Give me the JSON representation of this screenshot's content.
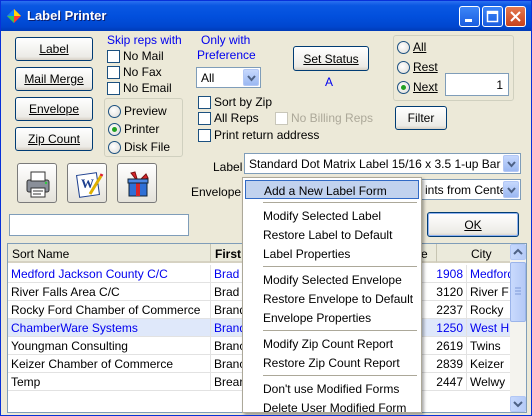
{
  "window": {
    "title": "Label Printer"
  },
  "left_buttons": [
    {
      "label": "Label"
    },
    {
      "label": "Mail Merge"
    },
    {
      "label": "Envelope"
    },
    {
      "label": "Zip Count"
    }
  ],
  "skip_reps": {
    "heading": "Skip reps with",
    "options": [
      {
        "label": "No Mail",
        "checked": false
      },
      {
        "label": "No Fax",
        "checked": false
      },
      {
        "label": "No Email",
        "checked": false
      }
    ]
  },
  "output": {
    "options": [
      {
        "label": "Preview",
        "selected": false
      },
      {
        "label": "Printer",
        "selected": true
      },
      {
        "label": "Disk File",
        "selected": false
      }
    ]
  },
  "preference": {
    "heading_line1": "Only with",
    "heading_line2": "Preference",
    "selected": "All"
  },
  "set_status": {
    "label": "Set Status",
    "status_value": "A"
  },
  "options_checks": [
    {
      "label": "Sort by Zip",
      "checked": false,
      "disabled": false
    },
    {
      "label": "All Reps",
      "checked": false,
      "disabled": false
    },
    {
      "label": "No Billing Reps",
      "checked": false,
      "disabled": true
    },
    {
      "label": "Print return address",
      "checked": false,
      "disabled": false
    }
  ],
  "range": {
    "options": [
      {
        "label": "All",
        "selected": false
      },
      {
        "label": "Rest",
        "selected": false
      },
      {
        "label": "Next",
        "selected": true
      }
    ],
    "next_count": "1"
  },
  "filter_button": {
    "label": "Filter"
  },
  "ok_button": {
    "label": "OK"
  },
  "label_select": {
    "caption": "Label",
    "value": "Standard Dot Matrix Label 15/16 x 3.5 1-up Bar"
  },
  "envelope_select": {
    "caption": "Envelope",
    "value": "ints from Cente"
  },
  "search": {
    "value": ""
  },
  "table": {
    "columns": [
      "Sort Name",
      "First",
      "e",
      "City"
    ],
    "rows": [
      {
        "sort_name": "Medford Jackson County C/C",
        "first": "Brad",
        "zip": "1908",
        "city": "Medford",
        "link": true,
        "selected": false
      },
      {
        "sort_name": "River Falls Area C/C",
        "first": "Brad",
        "zip": "3120",
        "city": "River F",
        "link": false,
        "selected": false
      },
      {
        "sort_name": "Rocky Ford Chamber of Commerce",
        "first": "Brand",
        "zip": "2237",
        "city": "Rocky",
        "link": false,
        "selected": false
      },
      {
        "sort_name": "ChamberWare Systems",
        "first": "Brand",
        "zip": "1250",
        "city": "West H",
        "link": true,
        "selected": true
      },
      {
        "sort_name": "Youngman Consulting",
        "first": "Branc",
        "zip": "2619",
        "city": "Twins",
        "link": false,
        "selected": false
      },
      {
        "sort_name": "Keizer Chamber of Commerce",
        "first": "Branc",
        "zip": "2839",
        "city": "Keizer",
        "link": false,
        "selected": false
      },
      {
        "sort_name": "Temp",
        "first": "Brear",
        "zip": "2447",
        "city": "Welwy",
        "link": false,
        "selected": false
      }
    ]
  },
  "context_menu": {
    "groups": [
      [
        "Add a New Label Form"
      ],
      [
        "Modify Selected Label",
        "Restore Label to Default",
        "Label Properties"
      ],
      [
        "Modify Selected Envelope",
        "Restore Envelope to Default",
        "Envelope Properties"
      ],
      [
        "Modify Zip Count Report",
        "Restore Zip Count Report"
      ],
      [
        "Don't use Modified Forms",
        "Delete User Modified Form"
      ]
    ],
    "highlighted": "Add a New Label Form"
  },
  "icons": {
    "app": "label-printer-icon",
    "toolbar": [
      "printer-icon",
      "document-edit-icon",
      "gift-box-icon"
    ]
  },
  "colors": {
    "link": "#0000ee",
    "title_bar": "#0250dd",
    "selection": "#dfe8fa"
  }
}
